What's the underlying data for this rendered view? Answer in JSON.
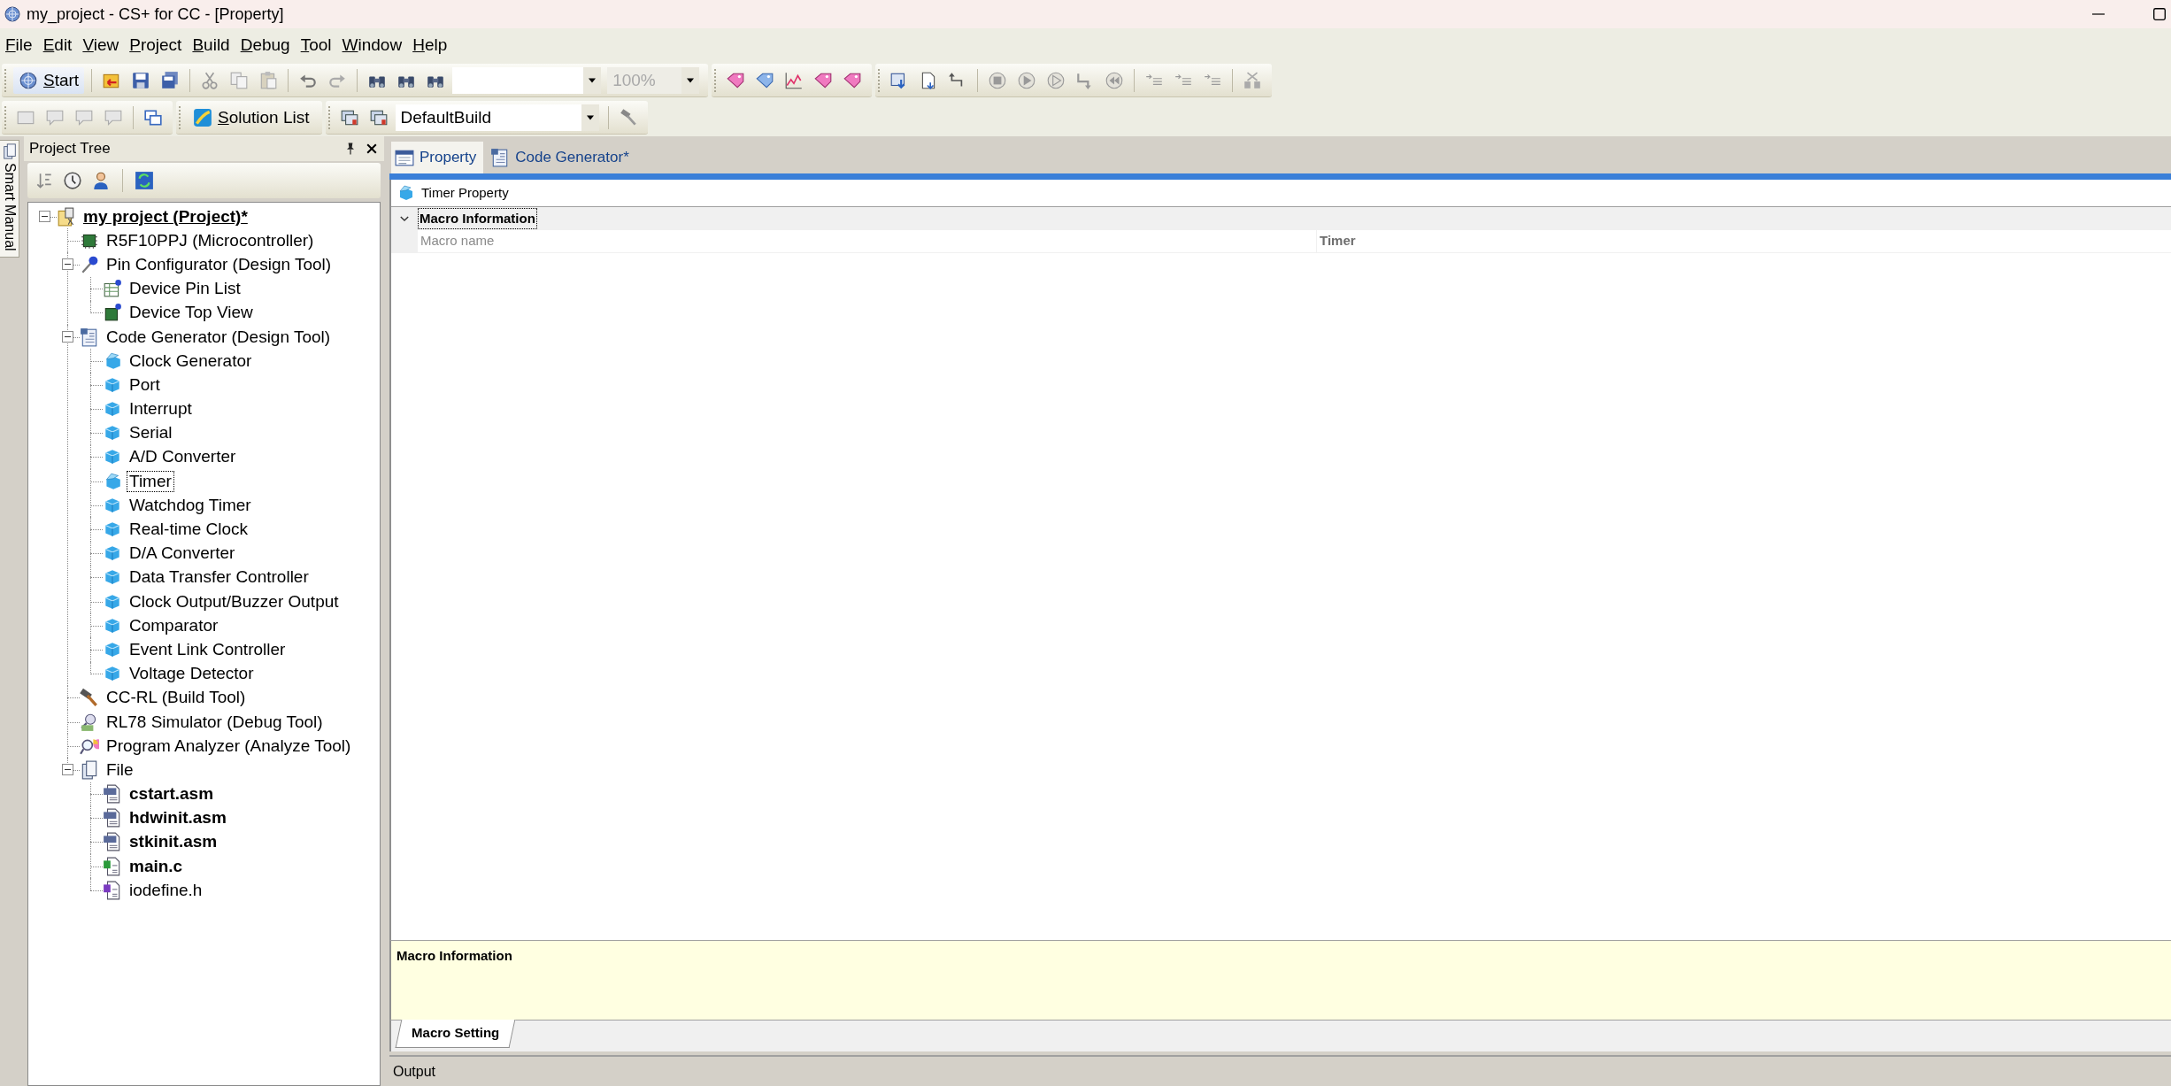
{
  "window": {
    "title": "my_project - CS+ for CC - [Property]"
  },
  "menu": [
    "File",
    "Edit",
    "View",
    "Project",
    "Build",
    "Debug",
    "Tool",
    "Window",
    "Help"
  ],
  "toolbar": {
    "start_button": "Start",
    "zoom_combo": {
      "value": "100%",
      "disabled": true
    },
    "solution_button": "Solution List",
    "build_mode_combo": {
      "value": "DefaultBuild"
    }
  },
  "side_tab": {
    "label": "Smart Manual"
  },
  "project_tree": {
    "title": "Project Tree",
    "nodes": [
      {
        "label": "my project (Project)*",
        "kind": "project",
        "bold": true,
        "underlined": true,
        "selected": false,
        "expanded": true,
        "children": [
          {
            "label": "R5F10PPJ (Microcontroller)",
            "kind": "microcontroller",
            "bold": false,
            "underlined": false,
            "selected": false
          },
          {
            "label": "Pin Configurator (Design Tool)",
            "kind": "pin-tool",
            "bold": false,
            "underlined": false,
            "selected": false,
            "expanded": true,
            "children": [
              {
                "label": "Device Pin List",
                "kind": "pin-list",
                "bold": false,
                "underlined": false,
                "selected": false
              },
              {
                "label": "Device Top View",
                "kind": "top-view",
                "bold": false,
                "underlined": false,
                "selected": false
              }
            ]
          },
          {
            "label": "Code Generator (Design Tool)",
            "kind": "codegen",
            "bold": false,
            "underlined": false,
            "selected": false,
            "expanded": true,
            "children": [
              {
                "label": "Clock Generator",
                "kind": "peripheral-set",
                "bold": false,
                "underlined": false,
                "selected": false
              },
              {
                "label": "Port",
                "kind": "peripheral",
                "bold": false,
                "underlined": false,
                "selected": false
              },
              {
                "label": "Interrupt",
                "kind": "peripheral",
                "bold": false,
                "underlined": false,
                "selected": false
              },
              {
                "label": "Serial",
                "kind": "peripheral",
                "bold": false,
                "underlined": false,
                "selected": false
              },
              {
                "label": "A/D Converter",
                "kind": "peripheral",
                "bold": false,
                "underlined": false,
                "selected": false
              },
              {
                "label": "Timer",
                "kind": "peripheral-set",
                "bold": false,
                "underlined": false,
                "selected": true
              },
              {
                "label": "Watchdog Timer",
                "kind": "peripheral",
                "bold": false,
                "underlined": false,
                "selected": false
              },
              {
                "label": "Real-time Clock",
                "kind": "peripheral",
                "bold": false,
                "underlined": false,
                "selected": false
              },
              {
                "label": "D/A Converter",
                "kind": "peripheral",
                "bold": false,
                "underlined": false,
                "selected": false
              },
              {
                "label": "Data Transfer Controller",
                "kind": "peripheral",
                "bold": false,
                "underlined": false,
                "selected": false
              },
              {
                "label": "Clock Output/Buzzer Output",
                "kind": "peripheral",
                "bold": false,
                "underlined": false,
                "selected": false
              },
              {
                "label": "Comparator",
                "kind": "peripheral",
                "bold": false,
                "underlined": false,
                "selected": false
              },
              {
                "label": "Event Link Controller",
                "kind": "peripheral",
                "bold": false,
                "underlined": false,
                "selected": false
              },
              {
                "label": "Voltage Detector",
                "kind": "peripheral",
                "bold": false,
                "underlined": false,
                "selected": false
              }
            ]
          },
          {
            "label": "CC-RL (Build Tool)",
            "kind": "build-tool",
            "bold": false,
            "underlined": false,
            "selected": false
          },
          {
            "label": "RL78 Simulator (Debug Tool)",
            "kind": "debug-tool",
            "bold": false,
            "underlined": false,
            "selected": false
          },
          {
            "label": "Program Analyzer (Analyze Tool)",
            "kind": "analyze-tool",
            "bold": false,
            "underlined": false,
            "selected": false
          },
          {
            "label": "File",
            "kind": "folder",
            "bold": false,
            "underlined": false,
            "selected": false,
            "expanded": true,
            "children": [
              {
                "label": "cstart.asm",
                "kind": "asm-file",
                "bold": true,
                "underlined": false,
                "selected": false
              },
              {
                "label": "hdwinit.asm",
                "kind": "asm-file",
                "bold": true,
                "underlined": false,
                "selected": false
              },
              {
                "label": "stkinit.asm",
                "kind": "asm-file",
                "bold": true,
                "underlined": false,
                "selected": false
              },
              {
                "label": "main.c",
                "kind": "c-file",
                "bold": true,
                "underlined": false,
                "selected": false
              },
              {
                "label": "iodefine.h",
                "kind": "h-file",
                "bold": false,
                "underlined": false,
                "selected": false
              }
            ]
          }
        ]
      }
    ]
  },
  "editor_tabs": [
    {
      "label": "Property",
      "selected": true
    },
    {
      "label": "Code Generator*",
      "selected": false
    }
  ],
  "property": {
    "header": "Timer Property",
    "categories": [
      {
        "label": "Macro Information",
        "expanded": true,
        "selected": true,
        "rows": [
          {
            "name": "Macro name",
            "value": "Timer"
          }
        ]
      }
    ],
    "description": {
      "title": "Macro Information"
    },
    "tabs": [
      {
        "label": "Macro Setting",
        "selected": true
      }
    ]
  },
  "output": {
    "title": "Output"
  }
}
